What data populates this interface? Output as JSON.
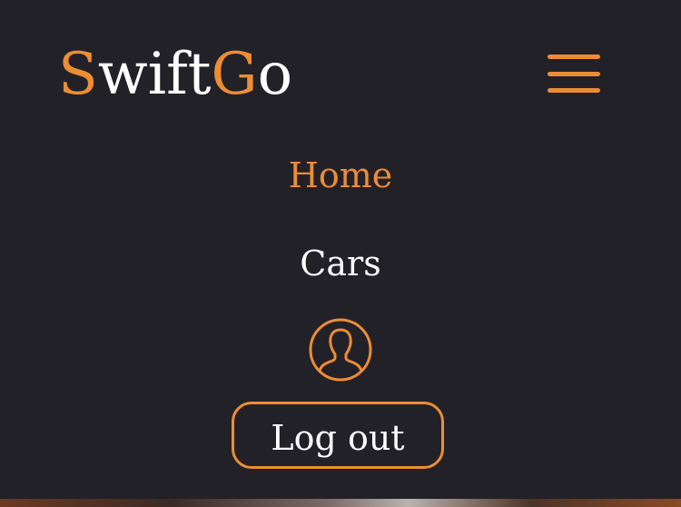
{
  "brand": {
    "first_letter": "S",
    "rest_part_one": "wift",
    "second_letter": "G",
    "rest_part_two": "o"
  },
  "menu": {
    "icon": "hamburger-menu-icon"
  },
  "nav": {
    "items": [
      {
        "label": "Home",
        "active": true
      },
      {
        "label": "Cars",
        "active": false
      }
    ]
  },
  "profile": {
    "icon": "user-icon"
  },
  "auth": {
    "logout_label": "Log out"
  },
  "colors": {
    "background": "#232128",
    "accent": "#ec8d36",
    "text": "#ffffff"
  }
}
